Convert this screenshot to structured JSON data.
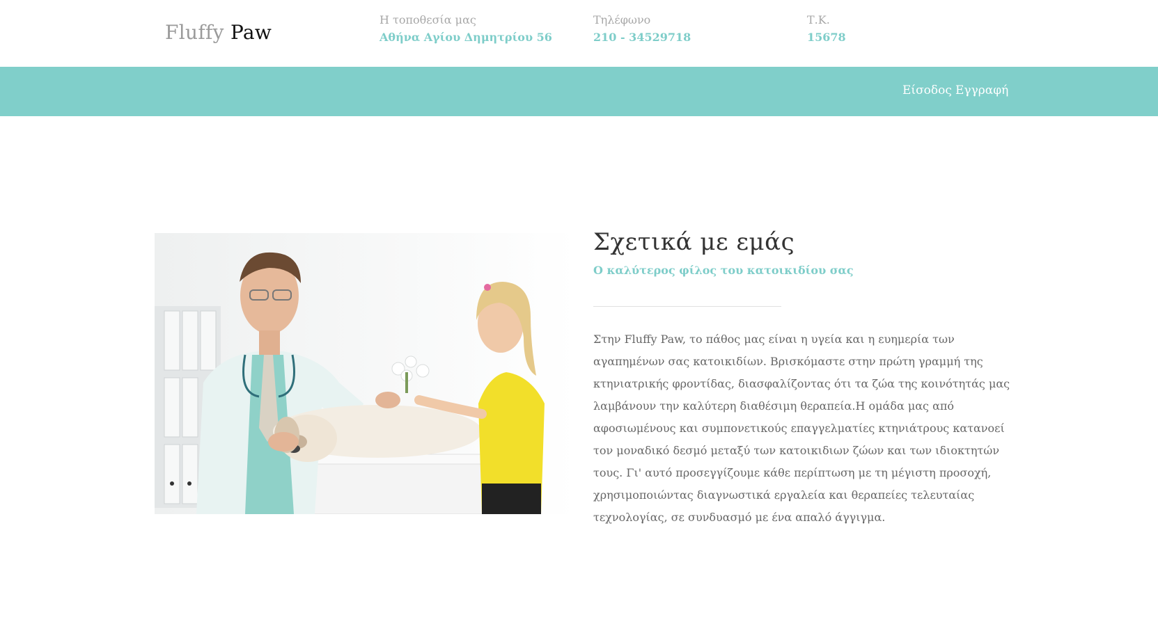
{
  "logo": {
    "light": "Fluffy",
    "dark": "Paw"
  },
  "info": [
    {
      "label": "Η τοποθεσία μας",
      "value": "Αθήνα Αγίου Δημητρίου 56"
    },
    {
      "label": "Τηλέφωνο",
      "value": "210 - 34529718"
    },
    {
      "label": "Τ.Κ.",
      "value": "15678"
    }
  ],
  "nav": {
    "login": "Είσοδος",
    "register": "Εγγραφή"
  },
  "colors": {
    "accent": "#80cfca",
    "accent_text": "#7ecdc9"
  },
  "about": {
    "title": "Σχετικά με εμάς",
    "subtitle": "Ο καλύτερος φίλος του κατοικιδίου σας",
    "body": "Στην Fluffy Paw, το πάθος μας είναι η υγεία και η ευημερία των αγαπημένων σας κατοικιδίων. Βρισκόμαστε στην πρώτη γραμμή της κτηνιατρικής φροντίδας, διασφαλίζοντας ότι τα ζώα της κοινότητάς μας λαμβάνουν την καλύτερη διαθέσιμη θεραπεία.Η ομάδα μας από αφοσιωμένους και συμπονετικούς επαγγελματίες κτηνιάτρους κατανοεί τον μοναδικό δεσμό μεταξύ των κατοικιδιων ζώων και των ιδιοκτητών τους. Γι' αυτό προσεγγίζουμε κάθε περίπτωση με τη μέγιστη προσοχή, χρησιμοποιώντας διαγνωστικά εργαλεία και θεραπείες τελευταίας τεχνολογίας, σε συνδυασμό με ένα απαλό άγγιγμα."
  },
  "photo_icon": "vet-with-dog-and-girl-image"
}
